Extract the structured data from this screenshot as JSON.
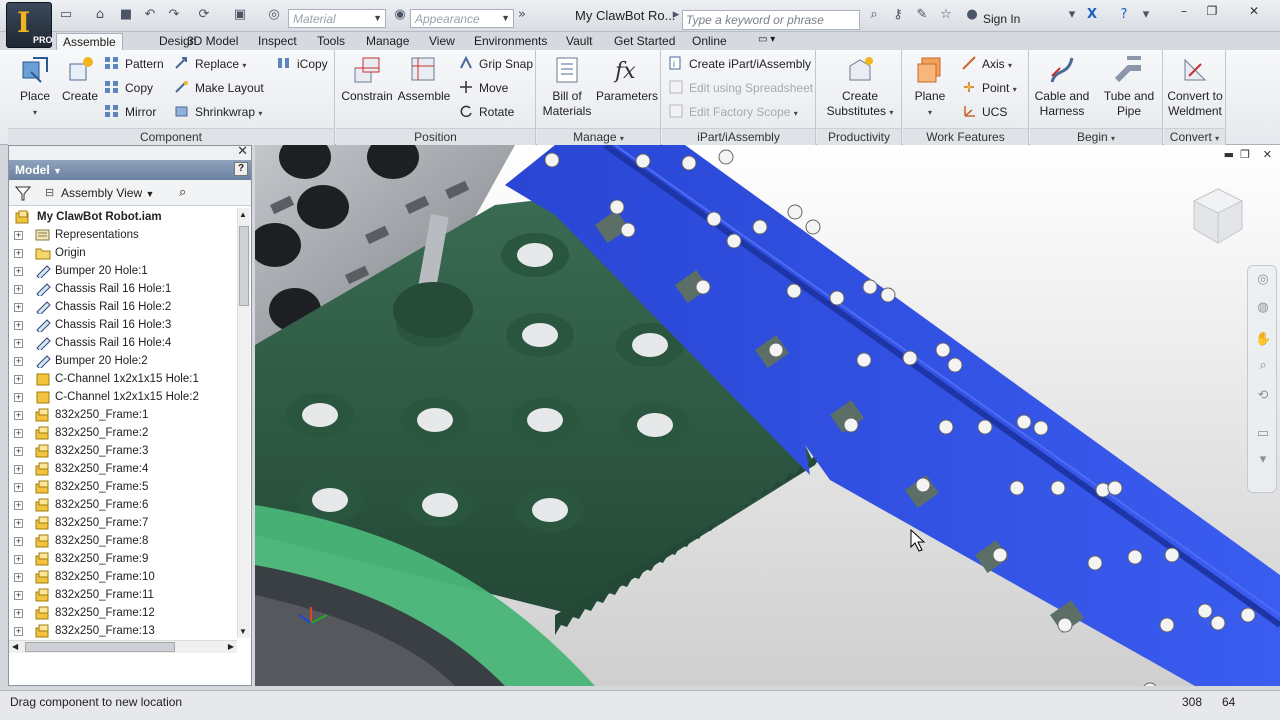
{
  "app": {
    "logo_letter": "I",
    "edition": "PRO",
    "material_placeholder": "Material",
    "appearance_placeholder": "Appearance",
    "document_title": "My ClawBot Ro...",
    "search_placeholder": "Type a keyword or phrase",
    "sign_in": "Sign In"
  },
  "tabs": [
    "Assemble",
    "Design",
    "3D Model",
    "Inspect",
    "Tools",
    "Manage",
    "View",
    "Environments",
    "Vault",
    "Get Started",
    "Online"
  ],
  "active_tab": "Assemble",
  "ribbon": {
    "component": {
      "title": "Component",
      "place": "Place",
      "create": "Create",
      "pattern": "Pattern",
      "copy": "Copy",
      "mirror": "Mirror",
      "replace": "Replace",
      "make_layout": "Make Layout",
      "shrinkwrap": "Shrinkwrap",
      "icopy": "iCopy"
    },
    "position": {
      "title": "Position",
      "constrain": "Constrain",
      "assemble": "Assemble",
      "grip_snap": "Grip Snap",
      "move": "Move",
      "rotate": "Rotate"
    },
    "manage": {
      "title": "Manage",
      "bom_line1": "Bill of",
      "bom_line2": "Materials",
      "parameters": "Parameters"
    },
    "ipart": {
      "title": "iPart/iAssembly",
      "create": "Create iPart/iAssembly",
      "edit_spreadsheet": "Edit using Spreadsheet",
      "edit_factory": "Edit Factory Scope"
    },
    "productivity": {
      "title": "Productivity",
      "line1": "Create",
      "line2": "Substitutes"
    },
    "work_features": {
      "title": "Work Features",
      "plane": "Plane",
      "axis": "Axis",
      "point": "Point",
      "ucs": "UCS"
    },
    "begin": {
      "title": "Begin",
      "cable_line1": "Cable and",
      "cable_line2": "Harness",
      "tube_line1": "Tube and",
      "tube_line2": "Pipe"
    },
    "convert": {
      "title": "Convert",
      "line1": "Convert to",
      "line2": "Weldment"
    }
  },
  "browser": {
    "title": "Model",
    "view_mode": "Assembly View",
    "root": "My ClawBot Robot.iam",
    "items": [
      {
        "label": "Representations",
        "icon": "representations-icon"
      },
      {
        "label": "Origin",
        "icon": "folder-icon"
      },
      {
        "label": "Bumper 20 Hole:1",
        "icon": "sheet-metal-part-icon"
      },
      {
        "label": "Chassis Rail 16 Hole:1",
        "icon": "sheet-metal-part-icon"
      },
      {
        "label": "Chassis Rail 16 Hole:2",
        "icon": "sheet-metal-part-icon"
      },
      {
        "label": "Chassis Rail 16 Hole:3",
        "icon": "sheet-metal-part-icon"
      },
      {
        "label": "Chassis Rail 16 Hole:4",
        "icon": "sheet-metal-part-icon"
      },
      {
        "label": "Bumper 20 Hole:2",
        "icon": "sheet-metal-part-icon"
      },
      {
        "label": "C-Channel 1x2x1x15 Hole:1",
        "icon": "part-icon"
      },
      {
        "label": "C-Channel 1x2x1x15 Hole:2",
        "icon": "part-icon"
      },
      {
        "label": "832x250_Frame:1",
        "icon": "subassembly-icon"
      },
      {
        "label": "832x250_Frame:2",
        "icon": "subassembly-icon"
      },
      {
        "label": "832x250_Frame:3",
        "icon": "subassembly-icon"
      },
      {
        "label": "832x250_Frame:4",
        "icon": "subassembly-icon"
      },
      {
        "label": "832x250_Frame:5",
        "icon": "subassembly-icon"
      },
      {
        "label": "832x250_Frame:6",
        "icon": "subassembly-icon"
      },
      {
        "label": "832x250_Frame:7",
        "icon": "subassembly-icon"
      },
      {
        "label": "832x250_Frame:8",
        "icon": "subassembly-icon"
      },
      {
        "label": "832x250_Frame:9",
        "icon": "subassembly-icon"
      },
      {
        "label": "832x250_Frame:10",
        "icon": "subassembly-icon"
      },
      {
        "label": "832x250_Frame:11",
        "icon": "subassembly-icon"
      },
      {
        "label": "832x250_Frame:12",
        "icon": "subassembly-icon"
      },
      {
        "label": "832x250_Frame:13",
        "icon": "subassembly-icon"
      }
    ]
  },
  "status": {
    "message": "Drag component to new location",
    "count1": "308",
    "count2": "64"
  },
  "colors": {
    "blue_rail": "#2f4fe0",
    "green_gear": "#2f5a45",
    "light_green": "#4fb97a",
    "gray_part": "#9a9ea3"
  }
}
